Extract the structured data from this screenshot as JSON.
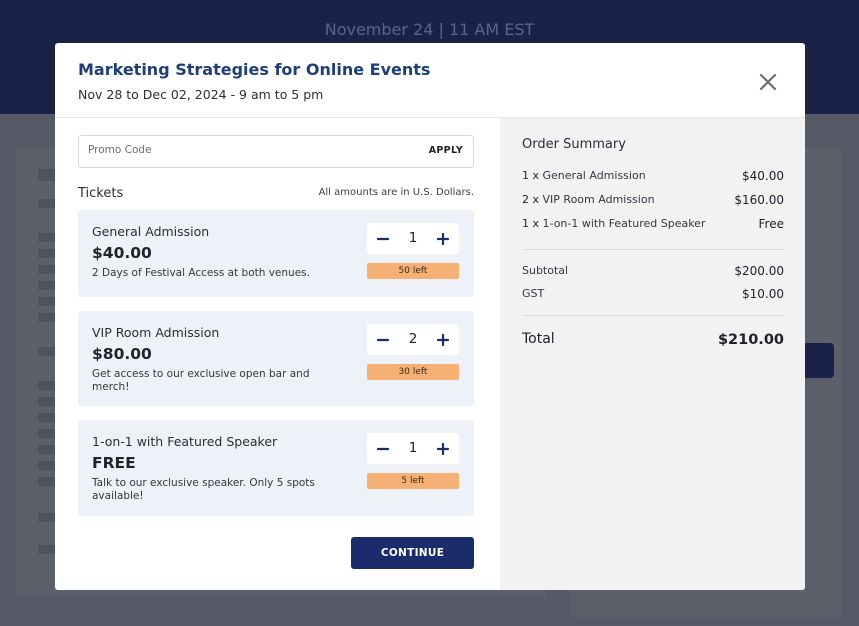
{
  "background": {
    "date_banner": "November 24 | 11 AM EST"
  },
  "modal": {
    "title": "Marketing Strategies for Online Events",
    "subtitle": "Nov 28 to Dec 02, 2024 - 9 am to 5 pm",
    "close_icon": "close-icon"
  },
  "promo": {
    "placeholder": "Promo Code",
    "value": "",
    "apply_label": "APPLY"
  },
  "tickets": {
    "heading": "Tickets",
    "currency_note": "All amounts are in U.S. Dollars.",
    "items": [
      {
        "name": "General Admission",
        "price": "$40.00",
        "description": "2 Days of Festival Access at both venues.",
        "quantity": "1",
        "remaining": "50 left"
      },
      {
        "name": "VIP Room Admission",
        "price": "$80.00",
        "description": "Get access to our exclusive open bar and merch!",
        "quantity": "2",
        "remaining": "30 left"
      },
      {
        "name": "1-on-1 with Featured Speaker",
        "price": "FREE",
        "description": "Talk to our exclusive speaker. Only 5 spots available!",
        "quantity": "1",
        "remaining": "5 left"
      }
    ]
  },
  "continue_label": "CONTINUE",
  "order_summary": {
    "title": "Order Summary",
    "lines": [
      {
        "qty": "1 x",
        "name": "General Admission",
        "amount": "$40.00"
      },
      {
        "qty": "2 x",
        "name": "VIP Room Admission",
        "amount": "$160.00"
      },
      {
        "qty": "1 x",
        "name": "1-on-1 with Featured Speaker",
        "amount": "Free"
      }
    ],
    "subtotal_label": "Subtotal",
    "subtotal": "$200.00",
    "tax_label": "GST",
    "tax": "$10.00",
    "total_label": "Total",
    "total": "$210.00"
  },
  "colors": {
    "accent": "#1a2c6b",
    "title": "#1f3f7a",
    "badge": "#f7b073"
  }
}
